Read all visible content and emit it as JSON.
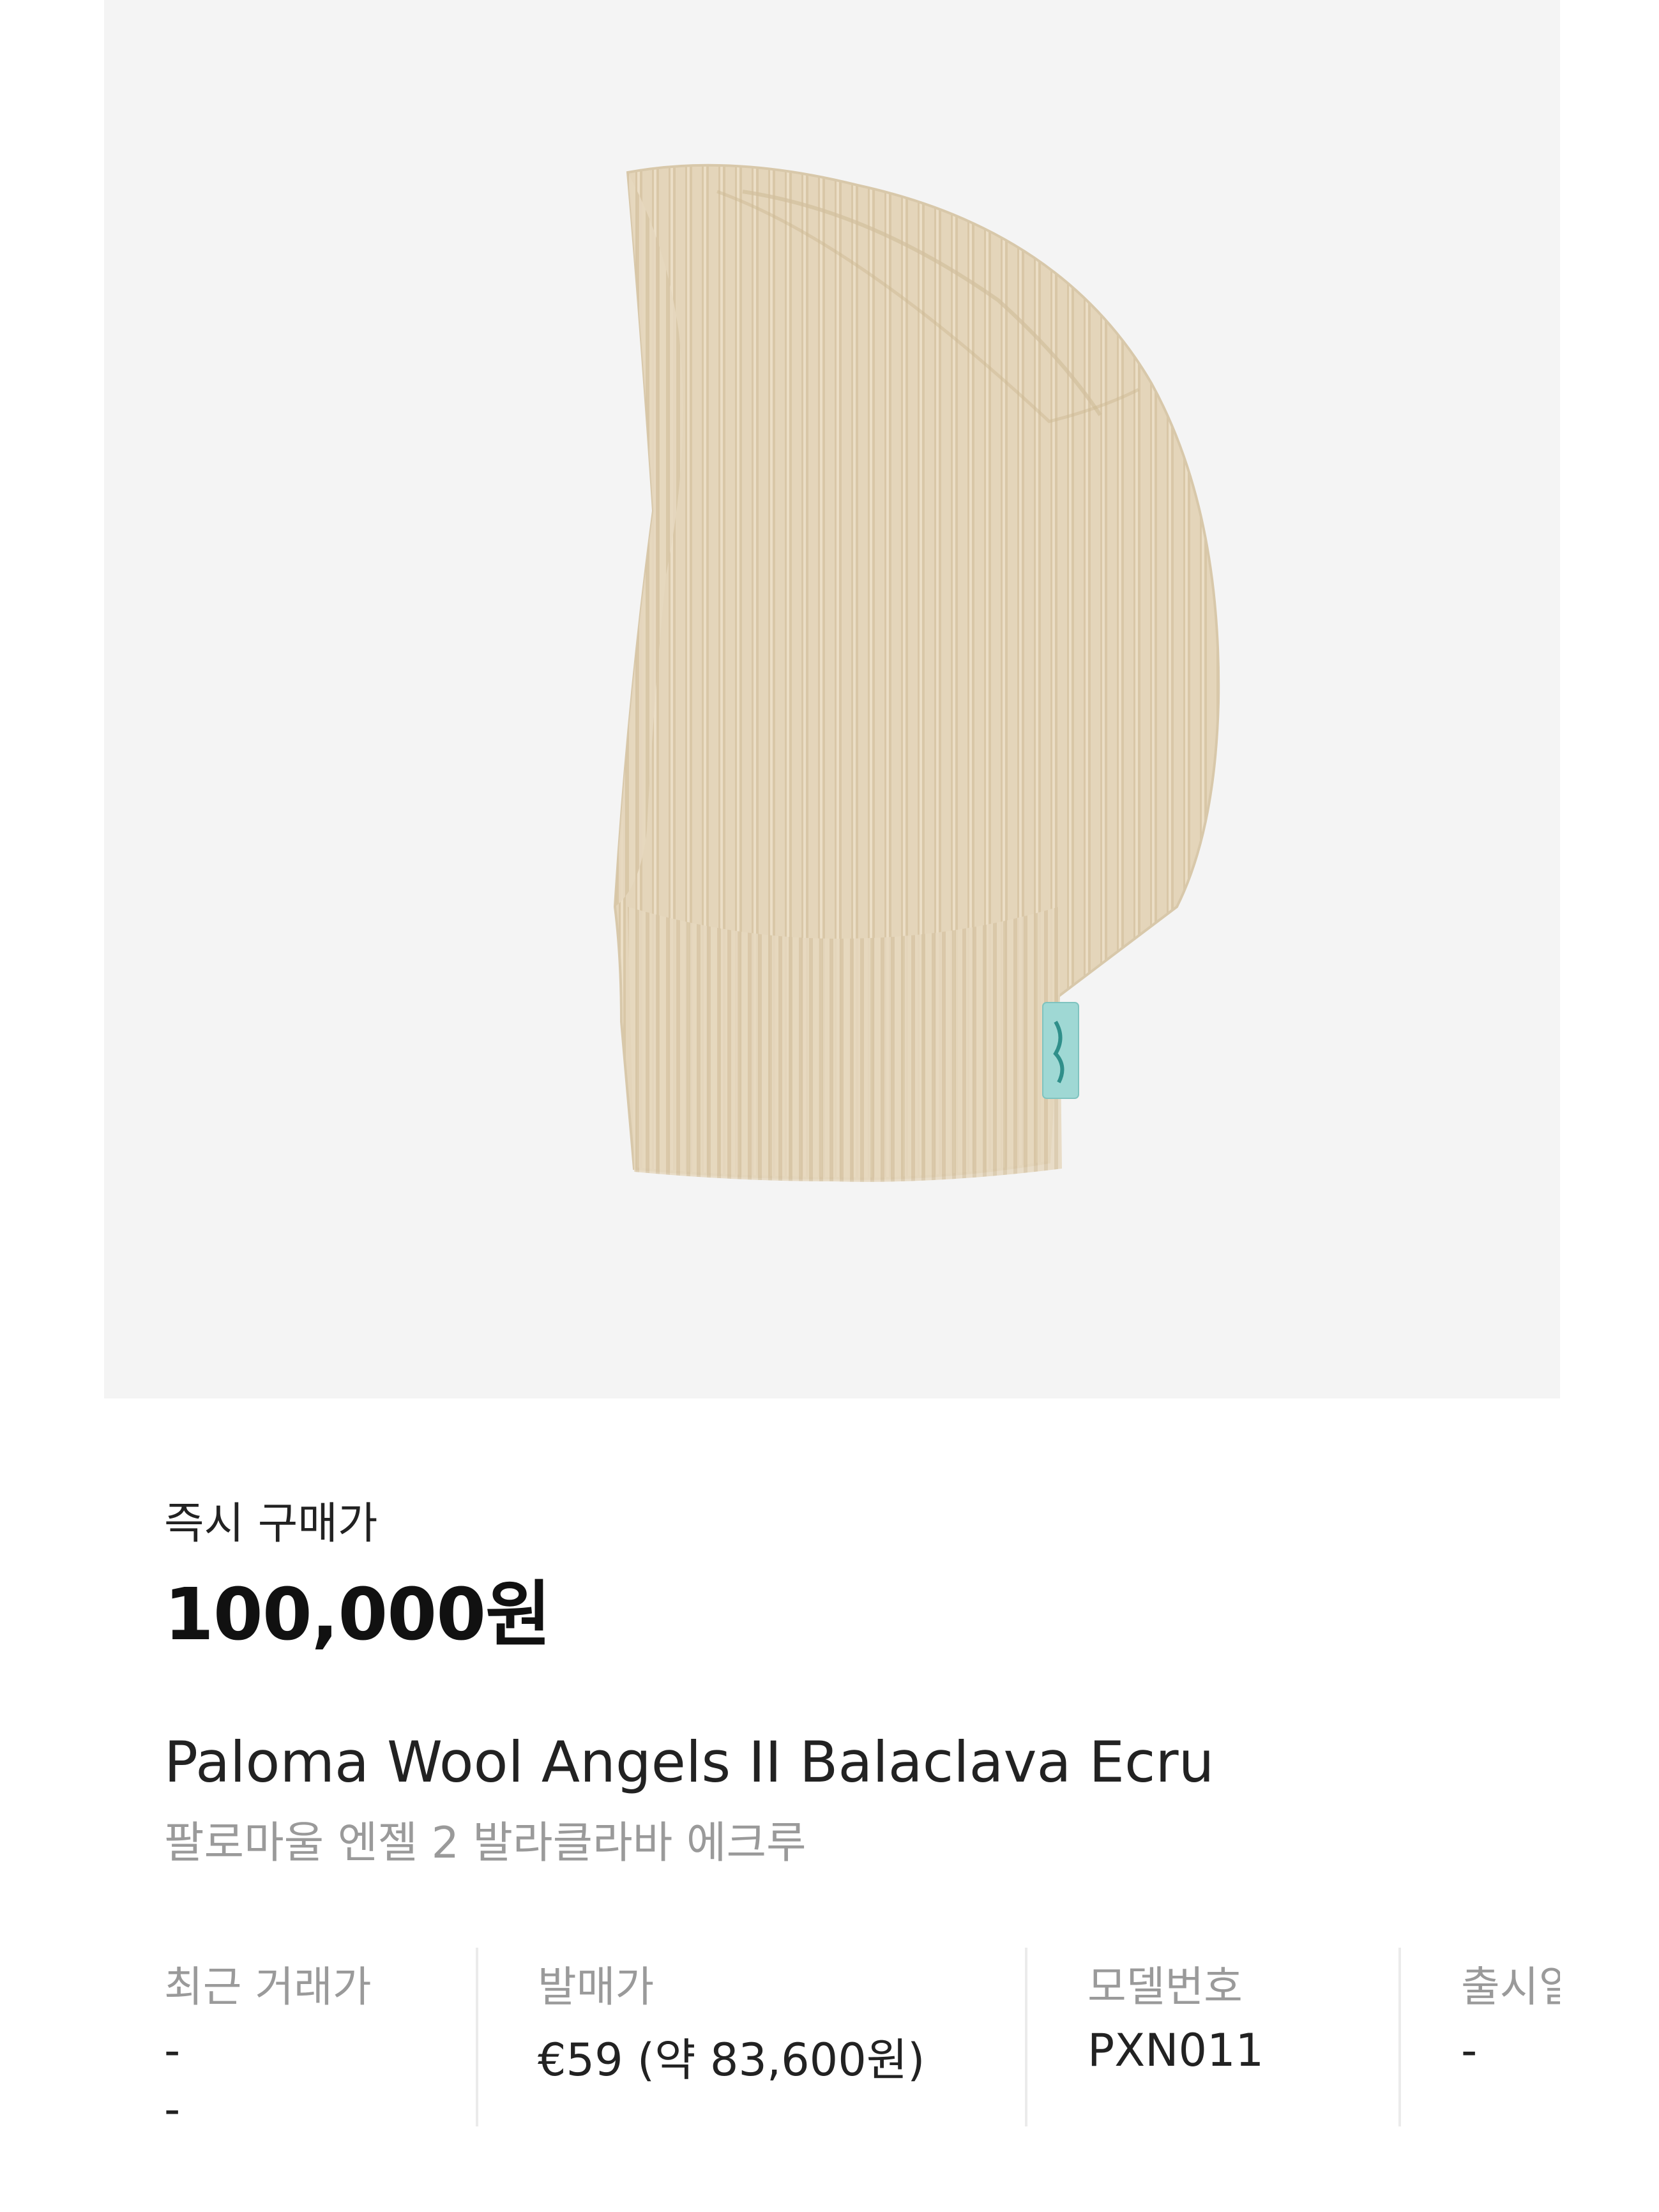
{
  "price": {
    "label": "즉시 구매가",
    "value": "100,000원"
  },
  "product": {
    "name_en": "Paloma Wool Angels II Balaclava Ecru",
    "name_ko": "팔로마울 엔젤 2 발라클라바 에크루"
  },
  "details": [
    {
      "title": "최근 거래가",
      "values": [
        "-",
        "-"
      ]
    },
    {
      "title": "발매가",
      "values": [
        "€59 (약 83,600원)"
      ]
    },
    {
      "title": "모델번호",
      "values": [
        "PXN011"
      ]
    },
    {
      "title": "출시일",
      "values": [
        "-"
      ]
    }
  ],
  "colors": {
    "image_background": "#f4f4f4",
    "knit": "#e3d3b8",
    "label_tag": "#9fd8d4"
  }
}
